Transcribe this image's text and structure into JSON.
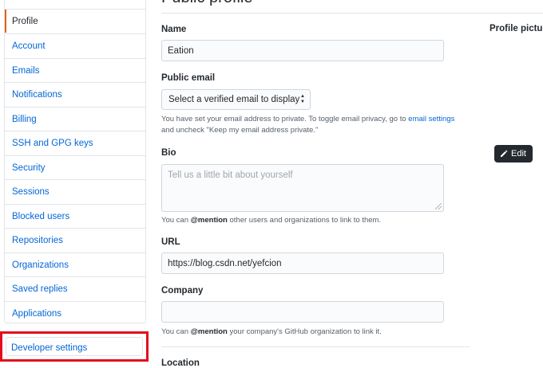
{
  "sidebar": {
    "items": [
      {
        "label": "Profile",
        "active": true
      },
      {
        "label": "Account"
      },
      {
        "label": "Emails"
      },
      {
        "label": "Notifications"
      },
      {
        "label": "Billing"
      },
      {
        "label": "SSH and GPG keys"
      },
      {
        "label": "Security"
      },
      {
        "label": "Sessions"
      },
      {
        "label": "Blocked users"
      },
      {
        "label": "Repositories"
      },
      {
        "label": "Organizations"
      },
      {
        "label": "Saved replies"
      },
      {
        "label": "Applications"
      }
    ],
    "developer_settings": "Developer settings",
    "highlight_color": "#e30d1b",
    "active_accent": "#e36209"
  },
  "main": {
    "title": "Public profile",
    "name": {
      "label": "Name",
      "value": "Eation"
    },
    "public_email": {
      "label": "Public email",
      "selected": "Select a verified email to display",
      "note_prefix": "You have set your email address to private. To toggle email privacy, go to",
      "note_link": "email settings",
      "note_suffix": "and uncheck \"Keep my email address private.\""
    },
    "bio": {
      "label": "Bio",
      "placeholder": "Tell us a little bit about yourself",
      "note_mention": "@mention",
      "note_rest": "other users and organizations to link to them.",
      "note_prefix": "You can"
    },
    "url": {
      "label": "URL",
      "value": "https://blog.csdn.net/yefcion"
    },
    "company": {
      "label": "Company",
      "value": "",
      "note_prefix": "You can",
      "note_mention": "@mention",
      "note_rest": "your company's GitHub organization to link it."
    },
    "location": {
      "label": "Location"
    }
  },
  "profile_picture": {
    "label": "Profile picture",
    "edit_label": "Edit",
    "edit_icon": "pencil-icon"
  },
  "colors": {
    "link": "#0366d6",
    "text": "#24292e",
    "border": "#e1e4e8"
  }
}
